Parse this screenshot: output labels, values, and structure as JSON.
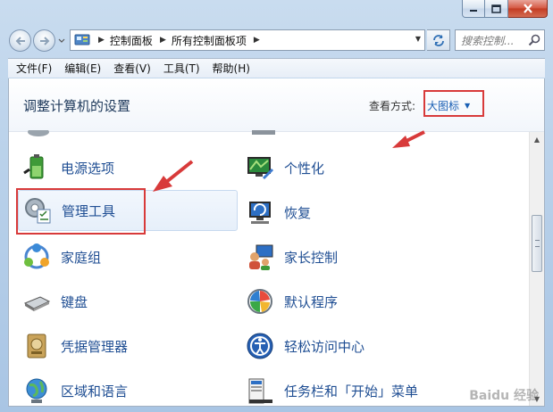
{
  "window": {
    "caption_buttons": [
      "minimize",
      "maximize",
      "close"
    ]
  },
  "address": {
    "crumbs": [
      "控制面板",
      "所有控制面板项"
    ]
  },
  "search": {
    "placeholder": "搜索控制..."
  },
  "menu": {
    "items": [
      "文件(F)",
      "编辑(E)",
      "查看(V)",
      "工具(T)",
      "帮助(H)"
    ]
  },
  "header": {
    "title": "调整计算机的设置",
    "view_label": "查看方式:",
    "view_value": "大图标"
  },
  "items_left": [
    {
      "label": "电源选项",
      "icon": "power-options-icon"
    },
    {
      "label": "管理工具",
      "icon": "admin-tools-icon"
    },
    {
      "label": "家庭组",
      "icon": "homegroup-icon"
    },
    {
      "label": "键盘",
      "icon": "keyboard-icon"
    },
    {
      "label": "凭据管理器",
      "icon": "credential-manager-icon"
    },
    {
      "label": "区域和语言",
      "icon": "region-language-icon"
    }
  ],
  "items_right": [
    {
      "label": "个性化",
      "icon": "personalization-icon"
    },
    {
      "label": "恢复",
      "icon": "recovery-icon"
    },
    {
      "label": "家长控制",
      "icon": "parental-controls-icon"
    },
    {
      "label": "默认程序",
      "icon": "default-programs-icon"
    },
    {
      "label": "轻松访问中心",
      "icon": "ease-of-access-icon"
    },
    {
      "label": "任务栏和「开始」菜单",
      "icon": "taskbar-start-menu-icon"
    }
  ],
  "watermark": "Baidu 经验",
  "colors": {
    "accent_link": "#1f4e93",
    "annotation_red": "#d83a3a"
  }
}
